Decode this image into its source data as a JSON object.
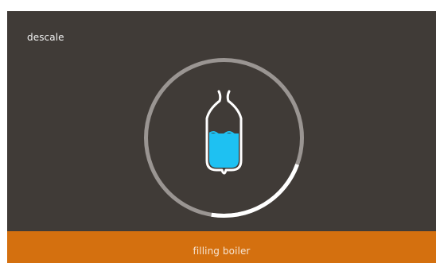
{
  "screen": {
    "title": "descale",
    "status_text": "filling boiler"
  },
  "progress": {
    "fraction": 0.22
  },
  "icon": {
    "name": "boiler-filling-icon",
    "fill_fraction": 0.6
  },
  "colors": {
    "background": "#403b37",
    "accent": "#d4700f",
    "water": "#1ec1f2",
    "ring_track": "#9a9592",
    "ring_progress": "#ffffff"
  }
}
